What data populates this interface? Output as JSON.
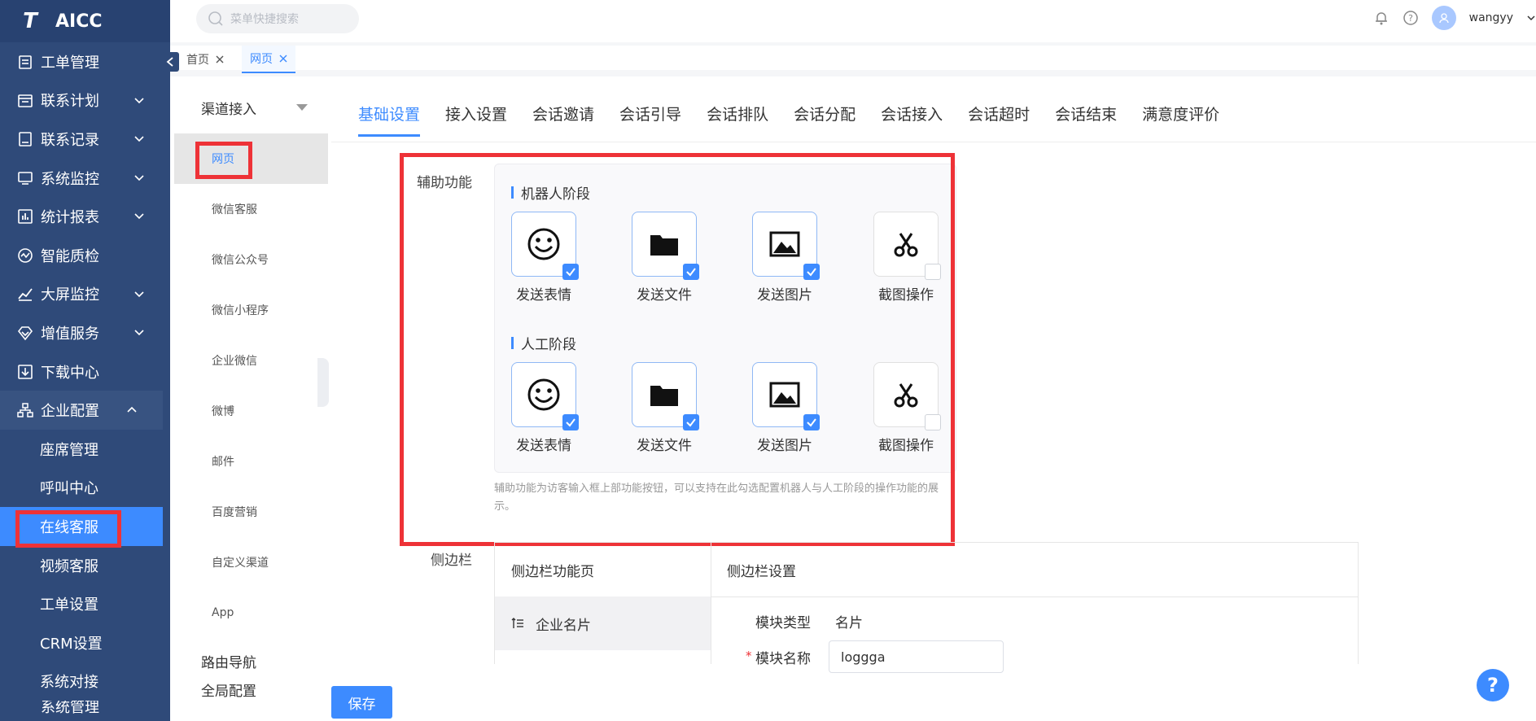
{
  "app": {
    "name": "AICC",
    "logo_letter": "T"
  },
  "search": {
    "placeholder": "菜单快捷搜索"
  },
  "user": {
    "name": "wangyy"
  },
  "sidebar": {
    "items": [
      {
        "label": "工单管理",
        "icon": "clipboard-icon",
        "arrow": false
      },
      {
        "label": "联系计划",
        "icon": "calendar-icon",
        "arrow": true
      },
      {
        "label": "联系记录",
        "icon": "record-icon",
        "arrow": true
      },
      {
        "label": "系统监控",
        "icon": "monitor-icon",
        "arrow": true
      },
      {
        "label": "统计报表",
        "icon": "chart-icon",
        "arrow": true
      },
      {
        "label": "智能质检",
        "icon": "quality-icon",
        "arrow": false
      },
      {
        "label": "大屏监控",
        "icon": "trend-icon",
        "arrow": true
      },
      {
        "label": "增值服务",
        "icon": "diamond-icon",
        "arrow": true
      },
      {
        "label": "下载中心",
        "icon": "download-icon",
        "arrow": false
      },
      {
        "label": "企业配置",
        "icon": "org-icon",
        "arrow": "up"
      }
    ],
    "sub_items": [
      "座席管理",
      "呼叫中心",
      "在线客服",
      "视频客服",
      "工单设置",
      "CRM设置",
      "系统对接"
    ],
    "active_sub": "在线客服",
    "last_item": "系统管理"
  },
  "page_tabs": [
    {
      "label": "首页"
    },
    {
      "label": "网页"
    }
  ],
  "channel_panel": {
    "group1": "渠道接入",
    "channels": [
      "网页",
      "微信客服",
      "微信公众号",
      "微信小程序",
      "企业微信",
      "微博",
      "邮件",
      "百度营销",
      "自定义渠道",
      "App"
    ],
    "group2": "路由导航",
    "group3": "全局配置"
  },
  "subtabs": [
    "基础设置",
    "接入设置",
    "会话邀请",
    "会话引导",
    "会话排队",
    "会话分配",
    "会话接入",
    "会话超时",
    "会话结束",
    "满意度评价"
  ],
  "assist": {
    "label": "辅助功能",
    "robot_stage": "机器人阶段",
    "human_stage": "人工阶段",
    "tools": [
      {
        "label": "发送表情",
        "icon": "smiley-icon"
      },
      {
        "label": "发送文件",
        "icon": "folder-icon"
      },
      {
        "label": "发送图片",
        "icon": "image-icon"
      },
      {
        "label": "截图操作",
        "icon": "scissors-icon"
      }
    ],
    "robot_checked": [
      true,
      true,
      true,
      false
    ],
    "human_checked": [
      true,
      true,
      true,
      false
    ],
    "hint": "辅助功能为访客输入框上部功能按钮，可以支持在此勾选配置机器人与人工阶段的操作功能的展示。"
  },
  "side_bar": {
    "label": "侧边栏",
    "col1": "侧边栏功能页",
    "col2": "侧边栏设置",
    "row1": "企业名片",
    "type_label": "模块类型",
    "type_value": "名片",
    "name_label": "模块名称",
    "name_value": "loggga",
    "required_mark": "*"
  },
  "save_label": "保存",
  "help_label": "?",
  "colors": {
    "sidebar": "#2f4a79",
    "accent": "#3d8bff",
    "highlight": "#ee3237"
  }
}
